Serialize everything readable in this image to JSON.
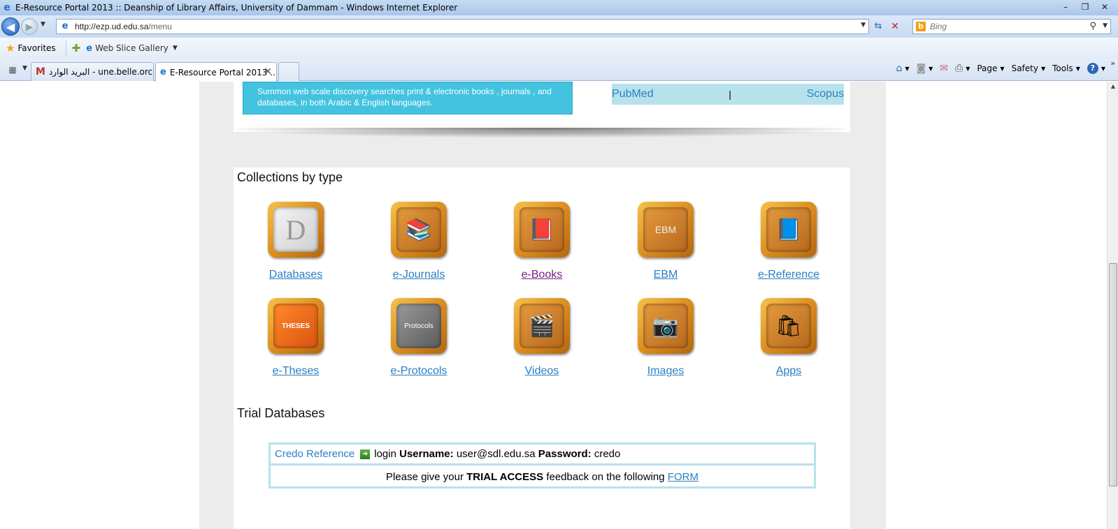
{
  "window": {
    "title": "E-Resource Portal 2013 :: Deanship of Library Affairs, University of Dammam - Windows Internet Explorer",
    "controls": {
      "minimize": "–",
      "restore": "❐",
      "close": "✕"
    }
  },
  "address_bar": {
    "url_host": "http://ezp.ud.edu.sa",
    "url_path": "/menu"
  },
  "search": {
    "placeholder": "Bing"
  },
  "favorites_bar": {
    "favorites_label": "Favorites",
    "web_slice_label": "Web Slice Gallery"
  },
  "tabs": [
    {
      "label": "البريد الوارد - une.belle.orch...",
      "active": false
    },
    {
      "label": "E-Resource Portal 2013 ...",
      "active": true
    }
  ],
  "command_bar": {
    "page": "Page",
    "safety": "Safety",
    "tools": "Tools"
  },
  "top_panel": {
    "summon_text": "Summon web scale discovery searches print & electronic books , journals , and databases, in both Arabic & English languages.",
    "db_links": [
      "PubMed",
      "|",
      "Scopus"
    ]
  },
  "collections": {
    "title": "Collections by type",
    "items": [
      {
        "label": "Databases",
        "glyph": "D"
      },
      {
        "label": "e-Journals",
        "glyph": "📚"
      },
      {
        "label": "e-Books",
        "glyph": "📕"
      },
      {
        "label": "EBM",
        "glyph": "EBM"
      },
      {
        "label": "e-Reference",
        "glyph": "📘"
      },
      {
        "label": "e-Theses",
        "glyph": "THESES"
      },
      {
        "label": "e-Protocols",
        "glyph": "Protocols"
      },
      {
        "label": "Videos",
        "glyph": "🎬"
      },
      {
        "label": "Images",
        "glyph": "📷"
      },
      {
        "label": "Apps",
        "glyph": "🛍"
      }
    ]
  },
  "trial": {
    "title": "Trial Databases",
    "credo_link": "Credo Reference",
    "login_text": "login",
    "username_label": "Username:",
    "username_value": "user@sdl.edu.sa",
    "password_label": "Password:",
    "password_value": "credo",
    "feedback_prefix": "Please give your",
    "feedback_bold": "TRIAL ACCESS",
    "feedback_middle": "feedback on the following",
    "feedback_link": "FORM"
  }
}
